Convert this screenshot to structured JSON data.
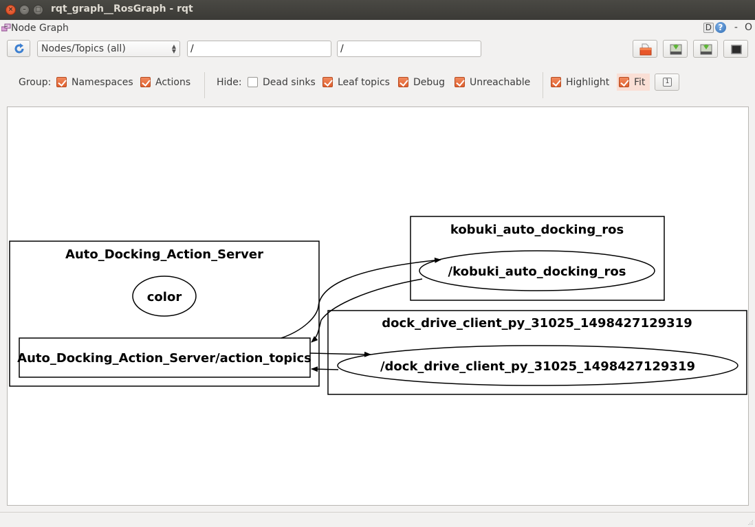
{
  "window": {
    "title": "rqt_graph__RosGraph - rqt",
    "controls": {
      "close": "×",
      "minimize": "–",
      "maximize": "□"
    }
  },
  "dock": {
    "title": "Node Graph",
    "d_label": "D",
    "help_label": "?",
    "minimize_label": "-",
    "float_label": "O"
  },
  "toolbar": {
    "refresh_icon": "refresh-icon",
    "graph_type": {
      "selected": "Nodes/Topics (all)"
    },
    "namespace_filter": {
      "value": "/"
    },
    "topic_filter": {
      "value": "/"
    },
    "tools": [
      {
        "name": "load-dot",
        "icon": "folder-open-icon"
      },
      {
        "name": "save-dot",
        "icon": "save-icon"
      },
      {
        "name": "save-svg",
        "icon": "save-icon"
      },
      {
        "name": "save-image",
        "icon": "screen-icon"
      }
    ]
  },
  "filters": {
    "group_label": "Group:",
    "group": [
      {
        "label": "Namespaces",
        "checked": true
      },
      {
        "label": "Actions",
        "checked": true
      }
    ],
    "hide_label": "Hide:",
    "hide": [
      {
        "label": "Dead sinks",
        "checked": false
      },
      {
        "label": "Leaf topics",
        "checked": true
      },
      {
        "label": "Debug",
        "checked": true
      },
      {
        "label": "Unreachable",
        "checked": true
      }
    ],
    "view": [
      {
        "label": "Highlight",
        "checked": true
      },
      {
        "label": "Fit",
        "checked": true
      }
    ],
    "fit_button_label": "1"
  },
  "graph": {
    "clusters": [
      {
        "id": "auto_docking_action_server",
        "label": "Auto_Docking_Action_Server"
      },
      {
        "id": "kobuki_auto_docking_ros",
        "label": "kobuki_auto_docking_ros"
      },
      {
        "id": "dock_drive_client",
        "label": "dock_drive_client_py_31025_1498427129319"
      }
    ],
    "nodes": [
      {
        "id": "color",
        "label": "color",
        "shape": "ellipse",
        "cluster": "auto_docking_action_server"
      },
      {
        "id": "action_topics",
        "label": "Auto_Docking_Action_Server/action_topics",
        "shape": "box",
        "cluster": "auto_docking_action_server"
      },
      {
        "id": "kobuki_node",
        "label": "/kobuki_auto_docking_ros",
        "shape": "ellipse",
        "cluster": "kobuki_auto_docking_ros"
      },
      {
        "id": "dock_client_node",
        "label": "/dock_drive_client_py_31025_1498427129319",
        "shape": "ellipse",
        "cluster": "dock_drive_client"
      }
    ],
    "edges": [
      {
        "from": "action_topics",
        "to": "kobuki_node"
      },
      {
        "from": "kobuki_node",
        "to": "action_topics"
      },
      {
        "from": "action_topics",
        "to": "dock_client_node"
      },
      {
        "from": "dock_client_node",
        "to": "action_topics"
      }
    ]
  }
}
